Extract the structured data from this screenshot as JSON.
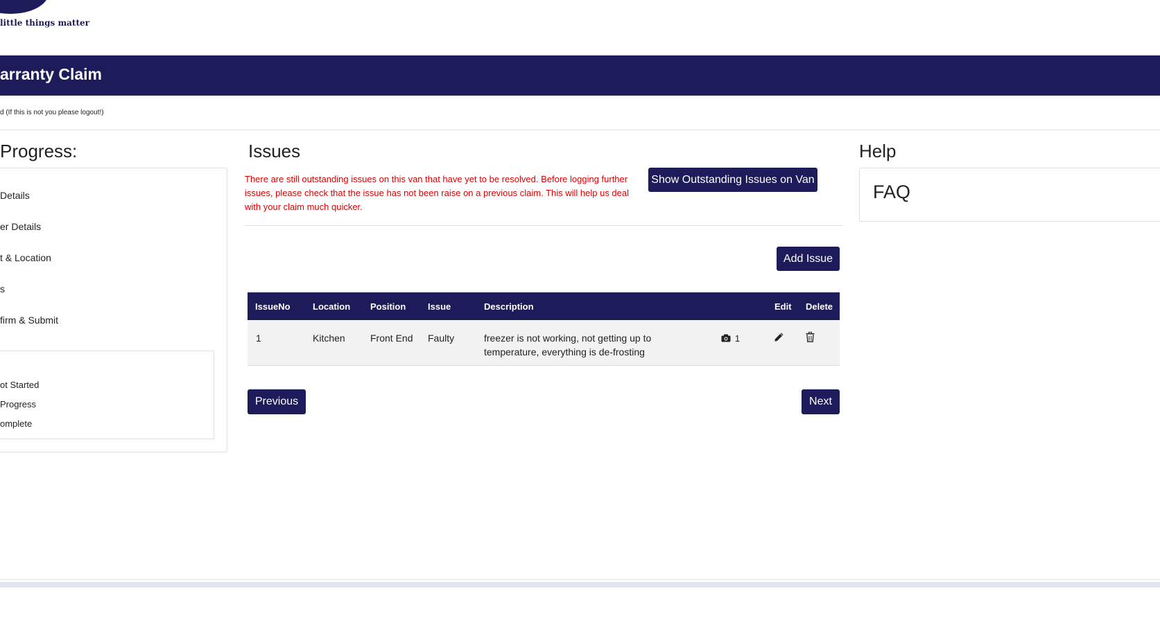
{
  "brand": {
    "tagline": "little things matter"
  },
  "header": {
    "title": "arranty Claim"
  },
  "user_note": "d (If this is not you please logout!)",
  "progress": {
    "title": "Progress:",
    "steps": [
      {
        "label": "Details"
      },
      {
        "label": "er Details"
      },
      {
        "label": "t & Location"
      },
      {
        "label": "s"
      },
      {
        "label": "firm & Submit"
      }
    ],
    "legend": [
      {
        "label": "ot Started"
      },
      {
        "label": " Progress"
      },
      {
        "label": "omplete"
      }
    ]
  },
  "issues": {
    "title": "Issues",
    "warning": "There are still outstanding issues on this van that have yet to be resolved. Before logging further issues, please check that the issue has not been raise on a previous claim. This will help us deal with your claim much quicker.",
    "show_outstanding_label": "Show Outstanding Issues on Van",
    "add_issue_label": "Add Issue",
    "table": {
      "headers": {
        "issue_no": "IssueNo",
        "location": "Location",
        "position": "Position",
        "issue": "Issue",
        "description": "Description",
        "edit": "Edit",
        "delete": "Delete"
      },
      "rows": [
        {
          "issue_no": "1",
          "location": "Kitchen",
          "position": "Front End",
          "issue": "Faulty",
          "description": "freezer is not working, not getting up to temperature, everything is de-frosting",
          "photo_count": "1"
        }
      ]
    },
    "previous_label": "Previous",
    "next_label": "Next"
  },
  "help": {
    "title": "Help",
    "faq": "FAQ"
  },
  "colors": {
    "brand_navy": "#1e1b5a",
    "warning_red": "#e00000"
  },
  "icons": {
    "photo": "camera-icon",
    "edit": "pencil-icon",
    "delete": "trash-icon"
  }
}
